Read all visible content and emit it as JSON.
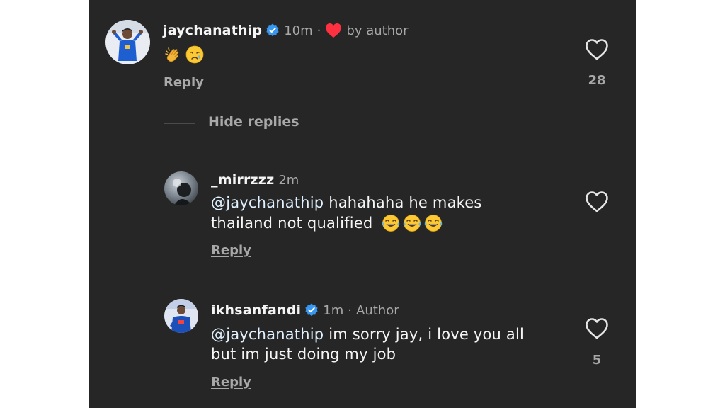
{
  "comments": [
    {
      "username": "jaychanathip",
      "verified": true,
      "time": "10m",
      "liked_by_author_label": "by author",
      "text": "",
      "emojis": [
        "clapping-hands",
        "crying-face"
      ],
      "reply_label": "Reply",
      "like_count": "28",
      "avatar_icon": "avatar-jaychanathip"
    },
    {
      "username": "_mirrzzz",
      "verified": false,
      "time": "2m",
      "mention": "@jaychanathip",
      "text_line1": " hahahaha he makes",
      "text_line2": "thailand not qualified",
      "emojis": [
        "tears-of-joy",
        "tears-of-joy",
        "tears-of-joy"
      ],
      "reply_label": "Reply",
      "like_count": "",
      "avatar_icon": "avatar-mirrzzz"
    },
    {
      "username": "ikhsanfandi",
      "verified": true,
      "time": "1m",
      "author_label": "Author",
      "mention": "@jaychanathip",
      "text_line1": " im sorry jay, i love you all",
      "text_line2": "but im just doing my job",
      "reply_label": "Reply",
      "like_count": "5",
      "avatar_icon": "avatar-ikhsanfandi"
    }
  ],
  "thread": {
    "hide_replies_label": "Hide replies"
  },
  "colors": {
    "background": "#262626",
    "text": "#f5f5f5",
    "muted": "#a8a8a8",
    "verified_blue": "#3897f0",
    "heart_red": "#ff3040",
    "mention": "#e0f1ff"
  }
}
